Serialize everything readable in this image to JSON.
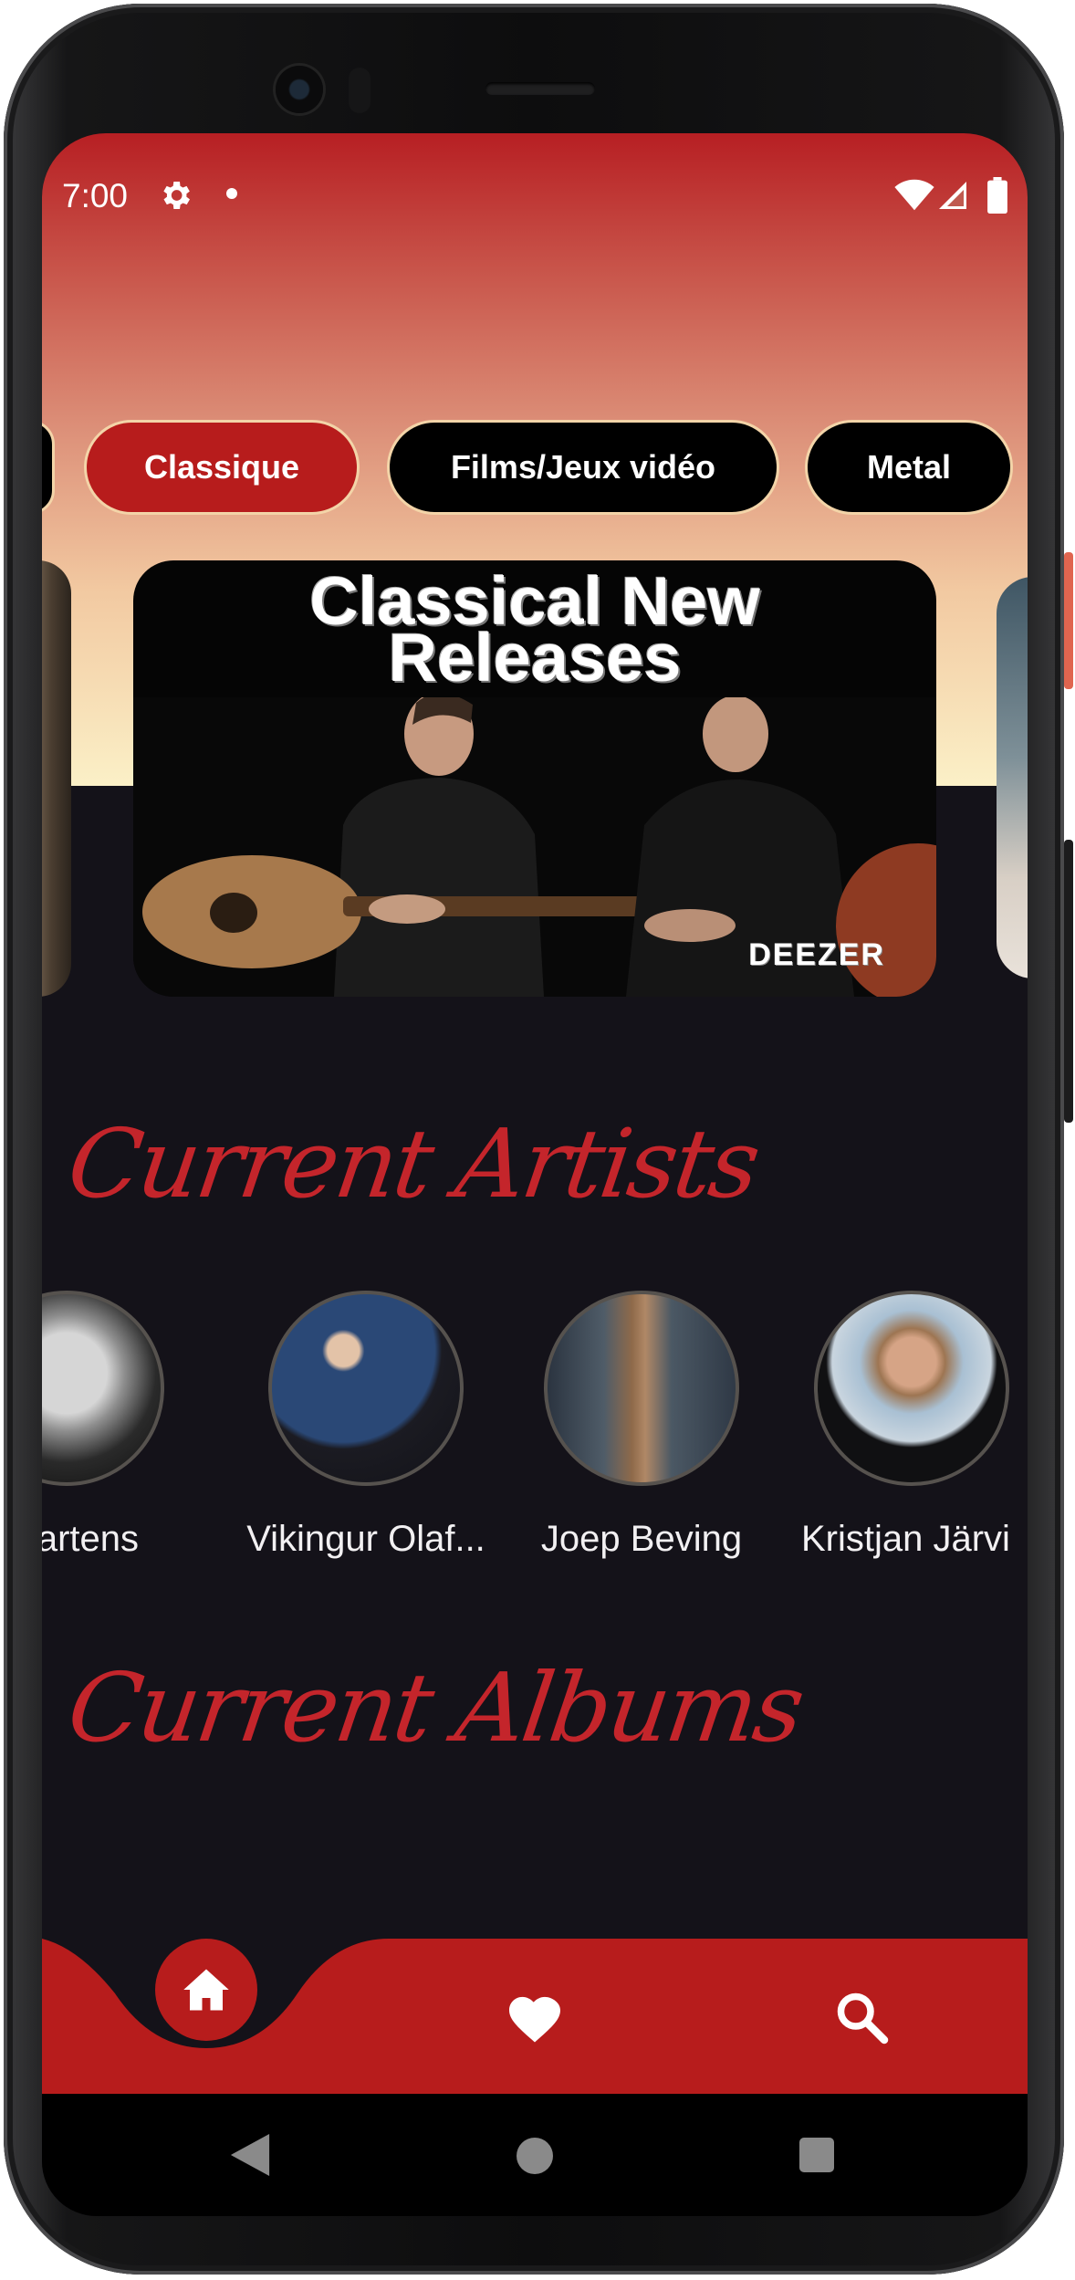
{
  "status_bar": {
    "time": "7:00"
  },
  "genres": {
    "items": [
      {
        "label": "Classique",
        "selected": true
      },
      {
        "label": "Films/Jeux vidéo",
        "selected": false
      },
      {
        "label": "Metal",
        "selected": false
      }
    ]
  },
  "carousel": {
    "featured_title_line1": "Classical New",
    "featured_title_line2": "Releases",
    "featured_brand": "DEEZER"
  },
  "artists_section": {
    "title": "Current Artists",
    "artists": [
      {
        "name": "Martens"
      },
      {
        "name": "Vikingur Olaf..."
      },
      {
        "name": "Joep Beving"
      },
      {
        "name": "Kristjan Järvi"
      }
    ]
  },
  "albums_section": {
    "title": "Current Albums"
  },
  "bottom_nav": {
    "items": [
      {
        "icon": "home-icon",
        "active": true
      },
      {
        "icon": "heart-icon",
        "active": false
      },
      {
        "icon": "search-icon",
        "active": false
      }
    ]
  },
  "colors": {
    "accent": "#b71c1c",
    "background": "#141219",
    "chip_border": "#f3d4a8",
    "text": "#f2f0f2"
  }
}
